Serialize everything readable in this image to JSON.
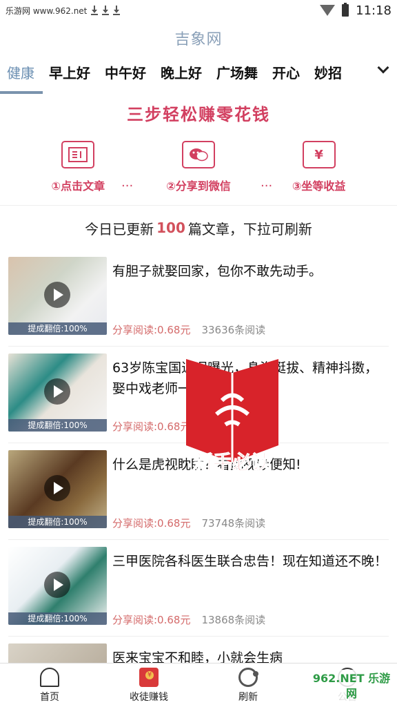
{
  "status": {
    "source": "乐游网 www.962.net",
    "time": "11:18"
  },
  "app": {
    "title": "吉象网"
  },
  "tabs": [
    "健康",
    "早上好",
    "中午好",
    "晚上好",
    "广场舞",
    "开心",
    "妙招"
  ],
  "promo": {
    "title": "三步轻松赚零花钱",
    "steps": [
      "①点击文章",
      "②分享到微信",
      "③坐等收益"
    ],
    "dots": "···",
    "yen": "¥"
  },
  "updated": {
    "prefix": "今日已更新",
    "count": "100",
    "suffix": "篇文章，下拉可刷新"
  },
  "articles": [
    {
      "title": "有胆子就娶回家，包你不敢先动手。",
      "earn": "分享阅读:0.68元",
      "reads": "33636条阅读",
      "badge": "提成翻倍:100%"
    },
    {
      "title": "63岁陈宝国近况曝光，身姿挺拔、精神抖擞，娶中戏老师一生幸福！",
      "earn": "分享阅读:0.68元",
      "reads": "条阅读",
      "badge": "提成翻倍:100%"
    },
    {
      "title": "什么是虎视眈眈？看此视频便知!",
      "earn": "分享阅读:0.68元",
      "reads": "73748条阅读",
      "badge": "提成翻倍:100%"
    },
    {
      "title": "三甲医院各科医生联合忠告！现在知道还不晚！",
      "earn": "分享阅读:0.68元",
      "reads": "13868条阅读",
      "badge": "提成翻倍:100%"
    },
    {
      "title": "医来宝宝不和睦，小就会生病"
    }
  ],
  "overlay": {
    "label": "新手必读"
  },
  "bottom_nav": [
    "首页",
    "收徒赚钱",
    "刷新",
    "公告"
  ],
  "watermark": "962.NET 乐游网"
}
